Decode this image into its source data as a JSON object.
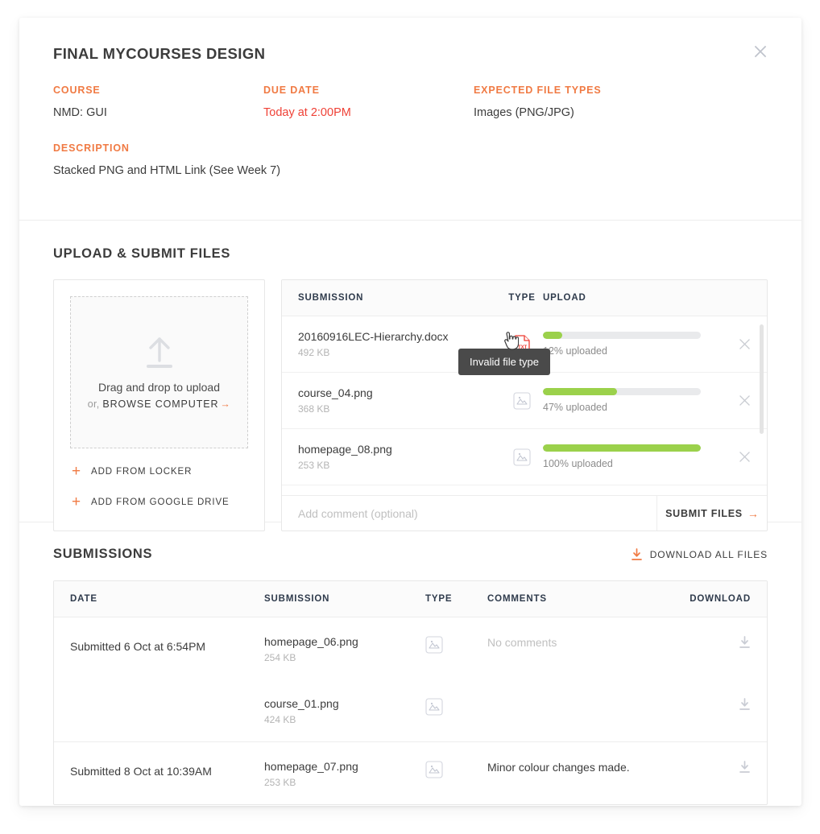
{
  "modal": {
    "title": "FINAL MYCOURSES DESIGN",
    "close_icon": "close-icon"
  },
  "meta": {
    "course_label": "COURSE",
    "course_value": "NMD: GUI",
    "due_label": "DUE DATE",
    "due_value": "Today at 2:00PM",
    "filetypes_label": "EXPECTED FILE TYPES",
    "filetypes_value": "Images (PNG/JPG)",
    "description_label": "DESCRIPTION",
    "description_value": "Stacked PNG and HTML Link (See Week 7)"
  },
  "upload": {
    "section_title": "UPLOAD & SUBMIT FILES",
    "dropzone": {
      "icon": "upload-arrow-icon",
      "line1": "Drag and drop to upload",
      "or_text": "or,",
      "browse_label": "BROWSE COMPUTER",
      "arrow": "→"
    },
    "add_sources": [
      {
        "label": "ADD FROM LOCKER",
        "icon": "plus-icon"
      },
      {
        "label": "ADD FROM GOOGLE DRIVE",
        "icon": "plus-icon"
      }
    ],
    "table": {
      "columns": [
        "SUBMISSION",
        "TYPE",
        "UPLOAD"
      ],
      "rows": [
        {
          "name": "20160916LEC-Hierarchy.docx",
          "size": "492 KB",
          "type_icon": "document-error-icon",
          "percent": 12,
          "progress_text": "12% uploaded",
          "remove_icon": "close-icon"
        },
        {
          "name": "course_04.png",
          "size": "368 KB",
          "type_icon": "image-icon",
          "percent": 47,
          "progress_text": "47% uploaded",
          "remove_icon": "close-icon"
        },
        {
          "name": "homepage_08.png",
          "size": "253 KB",
          "type_icon": "image-icon",
          "percent": 100,
          "progress_text": "100% uploaded",
          "remove_icon": "close-icon"
        }
      ]
    },
    "tooltip": "Invalid file type",
    "comment_placeholder": "Add comment (optional)",
    "comment_value": "",
    "submit_label": "SUBMIT FILES",
    "submit_arrow": "→"
  },
  "submissions": {
    "section_title": "SUBMISSIONS",
    "download_all_label": "DOWNLOAD ALL FILES",
    "download_all_icon": "download-icon",
    "columns": [
      "DATE",
      "SUBMISSION",
      "TYPE",
      "COMMENTS",
      "DOWNLOAD"
    ],
    "groups": [
      {
        "date": "Submitted 6 Oct at 6:54PM",
        "files": [
          {
            "name": "homepage_06.png",
            "size": "254 KB",
            "type_icon": "image-icon",
            "comment": "No comments",
            "comment_empty": true,
            "download_icon": "download-icon"
          },
          {
            "name": "course_01.png",
            "size": "424 KB",
            "type_icon": "image-icon",
            "comment": "",
            "comment_empty": false,
            "download_icon": "download-icon"
          }
        ]
      },
      {
        "date": "Submitted 8 Oct at 10:39AM",
        "files": [
          {
            "name": "homepage_07.png",
            "size": "253 KB",
            "type_icon": "image-icon",
            "comment": "Minor colour changes made.",
            "comment_empty": false,
            "download_icon": "download-icon"
          }
        ]
      }
    ]
  },
  "colors": {
    "accent": "#f07a43",
    "danger": "#ef4136",
    "progress": "#9bd14b",
    "text": "#3c3c3c",
    "muted": "#b4b4b4",
    "tooltip_bg": "#4a4a4a"
  }
}
